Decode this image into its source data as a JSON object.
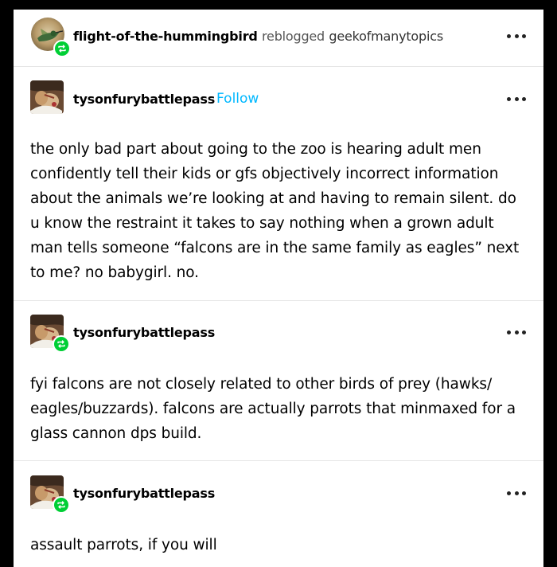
{
  "header": {
    "blog_name": "flight-of-the-hummingbird",
    "reblogged_text": "reblogged",
    "source_blog": "geekofmanytopics",
    "menu_icon": "more-dots-icon"
  },
  "posts": [
    {
      "username": "tysonfurybattlepass",
      "follow_label": "Follow",
      "text": "the only bad part about going to the zoo is hearing adult men confidently tell their kids or gfs objectively incorrect information about the animals we’re looking at and having to remain silent. do u know the restraint it takes to say nothing when a grown adult man tells someone “falcons are in the same family as eagles” next to me? no babygirl. no."
    },
    {
      "username": "tysonfurybattlepass",
      "text": "fyi falcons are not closely related to other birds of prey (hawks/ eagles/buzzards). falcons are actually parrots that minmaxed for a glass cannon dps build."
    },
    {
      "username": "tysonfurybattlepass",
      "text": "assault parrots, if you will"
    }
  ],
  "colors": {
    "follow": "#00b8ff",
    "reblog_badge": "#00cf35",
    "background": "#000000",
    "card": "#ffffff"
  },
  "icons": {
    "reblog": "reblog-icon",
    "more": "more-dots-icon"
  }
}
